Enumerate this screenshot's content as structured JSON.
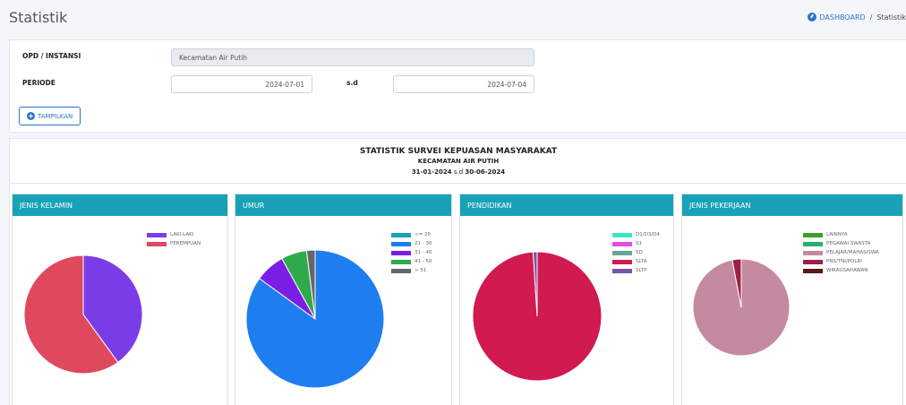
{
  "page": {
    "title": "Statistik"
  },
  "breadcrumb": {
    "home": "DASHBOARD",
    "separator": "/",
    "current": "Statistik"
  },
  "filter": {
    "opd_label": "OPD / INSTANSI",
    "opd_value": "Kecamatan Air Putih",
    "periode_label": "PERIODE",
    "date_from": "2024-07-01",
    "sd_label": "s.d",
    "date_to": "2024-07-04",
    "button_label": "TAMPILKAN"
  },
  "stats": {
    "title": "STATISTIK SURVEI KEPUASAN MASYARAKAT",
    "subtitle": "KECAMATAN AIR PUTIH",
    "range_from": "31-01-2024",
    "range_sep": "s.d",
    "range_to": "30-06-2024"
  },
  "colors": {
    "accent": "#17a2b8",
    "link": "#2a73c9"
  },
  "icons": {
    "dashboard": "dashboard-icon",
    "button": "plus-circle-icon"
  },
  "chart_data": [
    {
      "type": "pie",
      "title": "JENIS KELAMIN",
      "categories": [
        "LAKI-LAKI",
        "PEREMPUAN"
      ],
      "values": [
        40,
        60
      ],
      "colors": [
        "#7a3ce6",
        "#e0485e"
      ],
      "legend": "top-right"
    },
    {
      "type": "pie",
      "title": "UMUR",
      "categories": [
        "<= 20",
        "21 - 30",
        "31 - 40",
        "41 - 50",
        "> 51"
      ],
      "values": [
        0,
        85,
        7,
        6,
        2
      ],
      "colors": [
        "#17a2b8",
        "#1e7ef0",
        "#7a1ee6",
        "#2eaa4a",
        "#666666"
      ],
      "legend": "top-right"
    },
    {
      "type": "pie",
      "title": "PENDIDIKAN",
      "categories": [
        "D1/D3/D4",
        "S1",
        "SD",
        "SLTA",
        "SLTP"
      ],
      "values": [
        0,
        0,
        0,
        99,
        1
      ],
      "colors": [
        "#37e8c8",
        "#e64ce6",
        "#6aa39a",
        "#d01a50",
        "#7b52a8"
      ],
      "legend": "top-right"
    },
    {
      "type": "pie",
      "title": "JENIS PEKERJAAN",
      "categories": [
        "LAINNYA",
        "PEGAWAI SWASTA",
        "PELAJAR/MAHASISWA",
        "PNS/TNI/POLRI",
        "WIRAUSAHAWAN"
      ],
      "values": [
        0,
        0,
        97,
        3,
        0
      ],
      "colors": [
        "#3aa02a",
        "#28b06a",
        "#c48aa0",
        "#9c2046",
        "#5a1a10"
      ],
      "legend": "top-right"
    }
  ]
}
